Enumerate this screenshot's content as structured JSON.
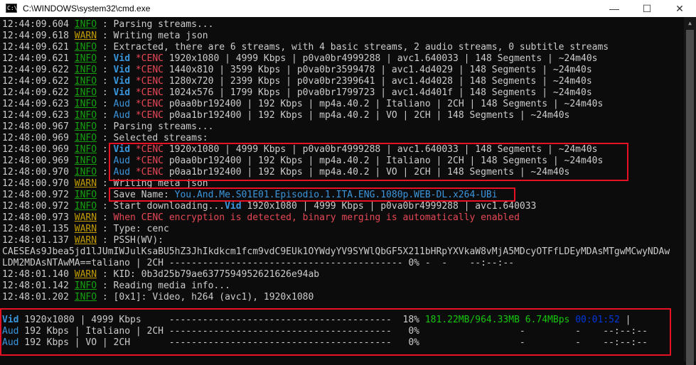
{
  "window": {
    "title": "C:\\WINDOWS\\system32\\cmd.exe",
    "icon_label": "C:\\",
    "minimize": "—",
    "maximize": "☐",
    "close": "✕"
  },
  "colors": {
    "background": "#0c0c0c",
    "text": "#cccccc",
    "info": "#13a10e",
    "warn": "#c19c00",
    "cyan": "#3a96dd",
    "red": "#e74856",
    "green": "#16c60c",
    "blue": "#0037da",
    "highlight_box": "#e81123"
  },
  "log": [
    {
      "segments": [
        {
          "t": "12:44:09.604 "
        },
        {
          "t": "INFO",
          "c": "info",
          "u": true
        },
        {
          "t": " : Parsing streams..."
        }
      ]
    },
    {
      "segments": [
        {
          "t": "12:44:09.618 "
        },
        {
          "t": "WARN",
          "c": "warn",
          "u": true
        },
        {
          "t": " : Writing meta json"
        }
      ]
    },
    {
      "segments": [
        {
          "t": "12:44:09.621 "
        },
        {
          "t": "INFO",
          "c": "info",
          "u": true
        },
        {
          "t": " : Extracted, there are 6 streams, with 4 basic streams, 2 audio streams, 0 subtitle streams"
        }
      ]
    },
    {
      "segments": [
        {
          "t": "12:44:09.621 "
        },
        {
          "t": "INFO",
          "c": "info",
          "u": true
        },
        {
          "t": " : "
        },
        {
          "t": "Vid",
          "c": "cyan",
          "b": true
        },
        {
          "t": " "
        },
        {
          "t": "*CENC",
          "c": "red"
        },
        {
          "t": " 1920x1080 | 4999 Kbps | p0va0br4999288 | avc1.640033 | 148 Segments | ~24m40s"
        }
      ]
    },
    {
      "segments": [
        {
          "t": "12:44:09.622 "
        },
        {
          "t": "INFO",
          "c": "info",
          "u": true
        },
        {
          "t": " : "
        },
        {
          "t": "Vid",
          "c": "cyan",
          "b": true
        },
        {
          "t": " "
        },
        {
          "t": "*CENC",
          "c": "red"
        },
        {
          "t": " 1440x810 | 3599 Kbps | p0va0br3599478 | avc1.4d4029 | 148 Segments | ~24m40s"
        }
      ]
    },
    {
      "segments": [
        {
          "t": "12:44:09.622 "
        },
        {
          "t": "INFO",
          "c": "info",
          "u": true
        },
        {
          "t": " : "
        },
        {
          "t": "Vid",
          "c": "cyan",
          "b": true
        },
        {
          "t": " "
        },
        {
          "t": "*CENC",
          "c": "red"
        },
        {
          "t": " 1280x720 | 2399 Kbps | p0va0br2399641 | avc1.4d4028 | 148 Segments | ~24m40s"
        }
      ]
    },
    {
      "segments": [
        {
          "t": "12:44:09.622 "
        },
        {
          "t": "INFO",
          "c": "info",
          "u": true
        },
        {
          "t": " : "
        },
        {
          "t": "Vid",
          "c": "cyan",
          "b": true
        },
        {
          "t": " "
        },
        {
          "t": "*CENC",
          "c": "red"
        },
        {
          "t": " 1024x576 | 1799 Kbps | p0va0br1799723 | avc1.4d401f | 148 Segments | ~24m40s"
        }
      ]
    },
    {
      "segments": [
        {
          "t": "12:44:09.623 "
        },
        {
          "t": "INFO",
          "c": "info",
          "u": true
        },
        {
          "t": " : "
        },
        {
          "t": "Aud",
          "c": "cyan"
        },
        {
          "t": " "
        },
        {
          "t": "*CENC",
          "c": "red"
        },
        {
          "t": " p0aa0br192400 | 192 Kbps | mp4a.40.2 | Italiano | 2CH | 148 Segments | ~24m40s"
        }
      ]
    },
    {
      "segments": [
        {
          "t": "12:44:09.623 "
        },
        {
          "t": "INFO",
          "c": "info",
          "u": true
        },
        {
          "t": " : "
        },
        {
          "t": "Aud",
          "c": "cyan"
        },
        {
          "t": " "
        },
        {
          "t": "*CENC",
          "c": "red"
        },
        {
          "t": " p0aa1br192400 | 192 Kbps | mp4a.40.2 | VO | 2CH | 148 Segments | ~24m40s"
        }
      ]
    },
    {
      "segments": [
        {
          "t": "12:48:00.967 "
        },
        {
          "t": "INFO",
          "c": "info",
          "u": true
        },
        {
          "t": " : Parsing streams..."
        }
      ]
    },
    {
      "segments": [
        {
          "t": "12:48:00.969 "
        },
        {
          "t": "INFO",
          "c": "info",
          "u": true
        },
        {
          "t": " : Selected streams:"
        }
      ]
    },
    {
      "segments": [
        {
          "t": "12:48:00.969 "
        },
        {
          "t": "INFO",
          "c": "info",
          "u": true
        },
        {
          "t": " : "
        },
        {
          "t": "Vid",
          "c": "cyan",
          "b": true
        },
        {
          "t": " "
        },
        {
          "t": "*CENC",
          "c": "red"
        },
        {
          "t": " 1920x1080 | 4999 Kbps | p0va0br4999288 | avc1.640033 | 148 Segments | ~24m40s"
        }
      ]
    },
    {
      "segments": [
        {
          "t": "12:48:00.969 "
        },
        {
          "t": "INFO",
          "c": "info",
          "u": true
        },
        {
          "t": " : "
        },
        {
          "t": "Aud",
          "c": "cyan"
        },
        {
          "t": " "
        },
        {
          "t": "*CENC",
          "c": "red"
        },
        {
          "t": " p0aa0br192400 | 192 Kbps | mp4a.40.2 | Italiano | 2CH | 148 Segments | ~24m40s"
        }
      ]
    },
    {
      "segments": [
        {
          "t": "12:48:00.970 "
        },
        {
          "t": "INFO",
          "c": "info",
          "u": true
        },
        {
          "t": " : "
        },
        {
          "t": "Aud",
          "c": "cyan"
        },
        {
          "t": " "
        },
        {
          "t": "*CENC",
          "c": "red"
        },
        {
          "t": " p0aa1br192400 | 192 Kbps | mp4a.40.2 | VO | 2CH | 148 Segments | ~24m40s"
        }
      ]
    },
    {
      "segments": [
        {
          "t": "12:48:00.970 "
        },
        {
          "t": "WARN",
          "c": "warn",
          "u": true
        },
        {
          "t": " : Writing meta json"
        }
      ]
    },
    {
      "segments": [
        {
          "t": "12:48:00.972 "
        },
        {
          "t": "INFO",
          "c": "info",
          "u": true
        },
        {
          "t": " : Save Name: "
        },
        {
          "t": "You.And.Me.S01E01.Episodio.1.ITA.ENG.1080p.WEB-DL.x264-UBi",
          "c": "cyan"
        }
      ]
    },
    {
      "segments": [
        {
          "t": "12:48:00.972 "
        },
        {
          "t": "INFO",
          "c": "info",
          "u": true
        },
        {
          "t": " : Start downloading..."
        },
        {
          "t": "Vid",
          "c": "cyan",
          "b": true
        },
        {
          "t": " 1920x1080 | 4999 Kbps | p0va0br4999288 | avc1.640033"
        }
      ]
    },
    {
      "segments": [
        {
          "t": "12:48:00.973 "
        },
        {
          "t": "WARN",
          "c": "warn",
          "u": true
        },
        {
          "t": " : "
        },
        {
          "t": "When CENC encryption is detected, binary merging is automatically enabled",
          "c": "red"
        }
      ]
    },
    {
      "segments": [
        {
          "t": "12:48:01.135 "
        },
        {
          "t": "WARN",
          "c": "warn",
          "u": true
        },
        {
          "t": " : Type: cenc"
        }
      ]
    },
    {
      "segments": [
        {
          "t": "12:48:01.137 "
        },
        {
          "t": "WARN",
          "c": "warn",
          "u": true
        },
        {
          "t": " : PSSH(WV):"
        }
      ]
    },
    {
      "segments": [
        {
          "t": "CAESEAs9Jbea5jd1lJUmIWJulKsaBU5hZ3JhIkdkcm1fcm9vdC9EUk1OYWdyYV9SYWlQbGF5X211bHRpYXVkaW8vMjA5MDcyOTFfLDEyMDAsMTgwMCwyNDAw"
        }
      ]
    },
    {
      "segments": [
        {
          "t": "LDM2MDAsNTAwMA==taliano | 2CH ------------------------------------------ 0% -  -    --:--:--"
        }
      ]
    },
    {
      "segments": [
        {
          "t": "12:48:01.140 "
        },
        {
          "t": "WARN",
          "c": "warn",
          "u": true
        },
        {
          "t": " : KID: 0b3d25b79ae6377594952621626e94ab"
        }
      ]
    },
    {
      "segments": [
        {
          "t": "12:48:01.142 "
        },
        {
          "t": "INFO",
          "c": "info",
          "u": true
        },
        {
          "t": " : Reading media info..."
        }
      ]
    },
    {
      "segments": [
        {
          "t": "12:48:01.202 "
        },
        {
          "t": "INFO",
          "c": "info",
          "u": true
        },
        {
          "t": " : [0x1]: Video, h264 (avc1), 1920x1080"
        }
      ]
    }
  ],
  "progress": [
    {
      "segments": [
        {
          "t": "Vid",
          "c": "cyan",
          "b": true
        },
        {
          "t": " 1920x1080 | 4999 Kbps     ----------------------------------------  18% "
        },
        {
          "t": "181.22MB/964.33MB",
          "c": "green"
        },
        {
          "t": " "
        },
        {
          "t": "6.74MBps",
          "c": "green"
        },
        {
          "t": " "
        },
        {
          "t": "00:01:52",
          "c": "blue"
        },
        {
          "t": " |"
        }
      ]
    },
    {
      "segments": [
        {
          "t": "Aud",
          "c": "cyan"
        },
        {
          "t": " 192 Kbps | Italiano | 2CH ----------------------------------------   0%                  -         -    --:--:--"
        }
      ]
    },
    {
      "segments": [
        {
          "t": "Aud",
          "c": "cyan"
        },
        {
          "t": " 192 Kbps | VO | 2CH       ----------------------------------------   0%                  -         -    --:--:--"
        }
      ]
    }
  ]
}
